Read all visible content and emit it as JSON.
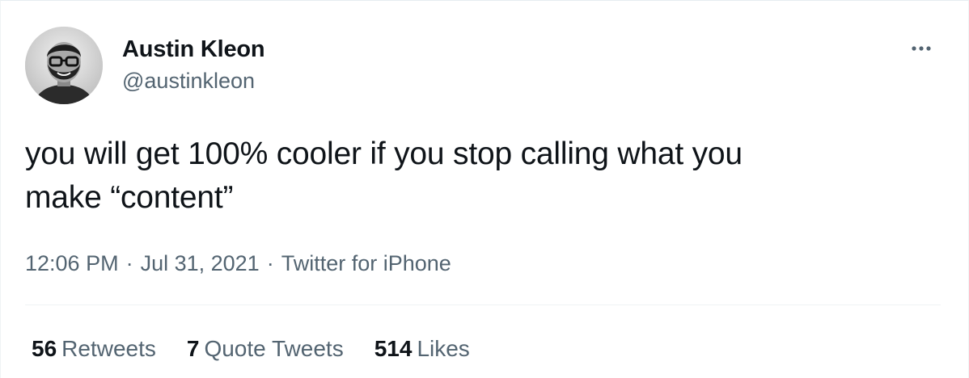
{
  "tweet": {
    "author": {
      "display_name": "Austin Kleon",
      "handle": "@austinkleon",
      "avatar_icon": "profile-photo"
    },
    "more_icon": "more-horizontal-icon",
    "text_lines": [
      "you will get 100% cooler if you stop calling what you",
      "make “content”"
    ],
    "meta": {
      "time": "12:06 PM",
      "separator": "·",
      "date": "Jul 31, 2021",
      "source": "Twitter for iPhone"
    },
    "stats": {
      "retweets": {
        "count": "56",
        "label": "Retweets"
      },
      "quote_tweets": {
        "count": "7",
        "label": "Quote Tweets"
      },
      "likes": {
        "count": "514",
        "label": "Likes"
      }
    }
  },
  "colors": {
    "text_primary": "#0f1419",
    "text_secondary": "#536471",
    "divider": "#eff3f4",
    "background": "#ffffff"
  }
}
